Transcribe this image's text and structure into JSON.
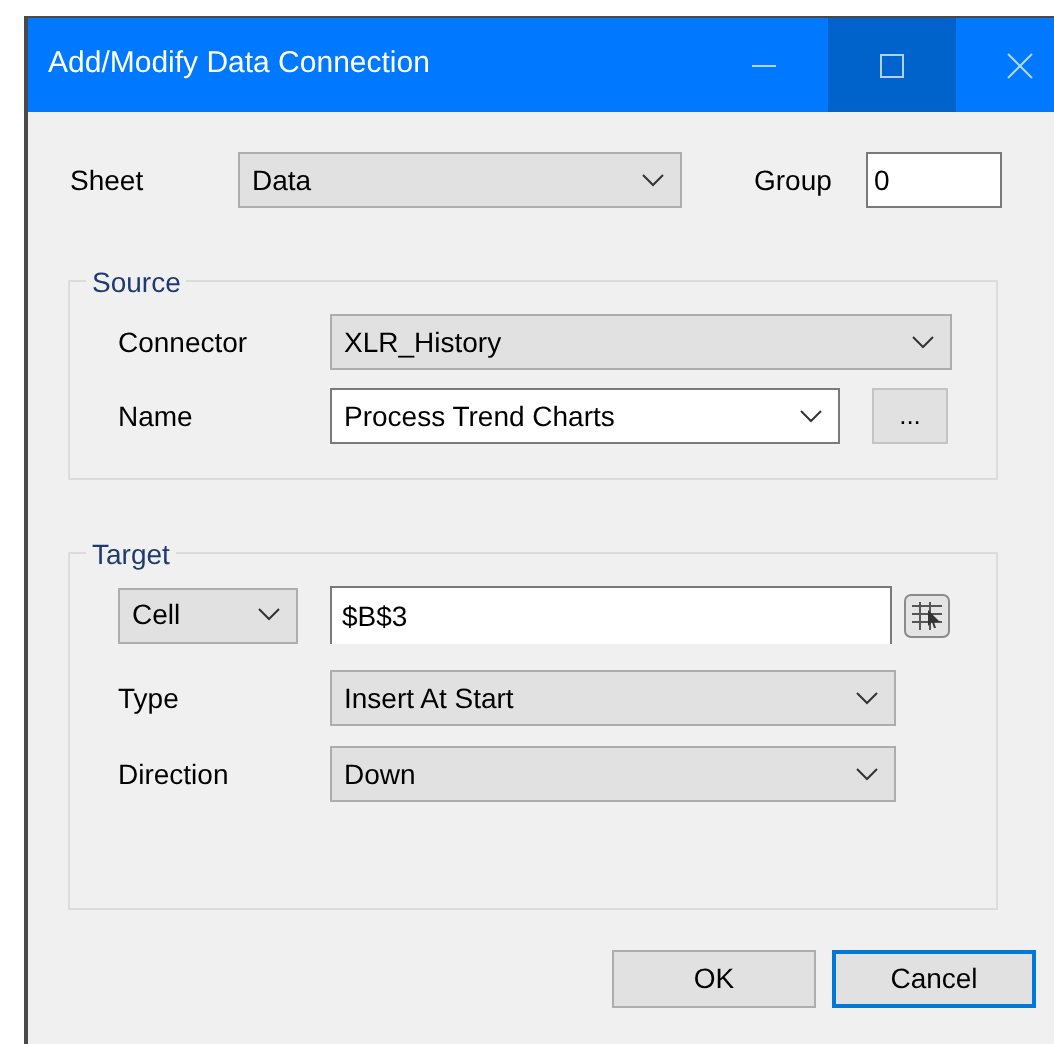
{
  "window": {
    "title": "Add/Modify Data Connection",
    "controls": [
      {
        "kind": "minimize",
        "hovered": false
      },
      {
        "kind": "maximize",
        "hovered": true
      },
      {
        "kind": "close",
        "hovered": false
      }
    ]
  },
  "sheet": {
    "label": "Sheet",
    "value": "Data",
    "kind": "list"
  },
  "group": {
    "label": "Group",
    "value": "0"
  },
  "source": {
    "title": "Source",
    "fields": [
      {
        "label": "Connector",
        "value": "XLR_History",
        "kind": "list"
      },
      {
        "label": "Name",
        "value": "Process Trend Charts",
        "kind": "editable"
      }
    ],
    "browse_button": "..."
  },
  "target": {
    "title": "Target",
    "range_type": {
      "value": "Cell",
      "kind": "list"
    },
    "cell": "$B$3",
    "fields": [
      {
        "label": "Type",
        "value": "Insert At Start",
        "kind": "list"
      },
      {
        "label": "Direction",
        "value": "Down",
        "kind": "list"
      }
    ]
  },
  "buttons": [
    {
      "label": "OK",
      "focused": false
    },
    {
      "label": "Cancel",
      "focused": true
    }
  ]
}
